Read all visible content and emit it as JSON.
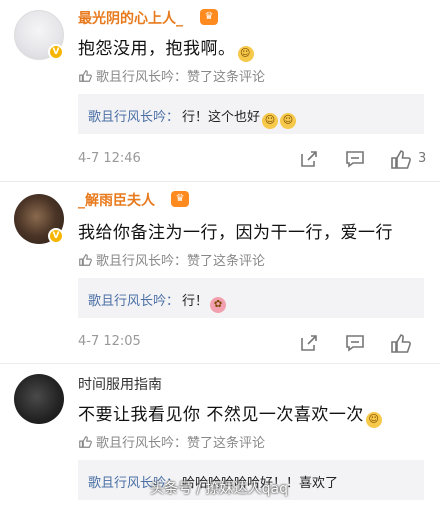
{
  "comments": [
    {
      "username": "最光阴的心上人_",
      "text": "抱怨没用，抱我啊。",
      "liked_by": "歌且行风长吟：赞了这条评论",
      "reply": {
        "name": "歌且行风长吟：",
        "text": "行！这个也好"
      },
      "timestamp": "4-7 12:46",
      "like_count": "3"
    },
    {
      "username": "_解雨臣夫人",
      "text": "我给你备注为一行，因为干一行，爱一行",
      "liked_by": "歌且行风长吟：赞了这条评论",
      "reply": {
        "name": "歌且行风长吟：",
        "text": "行！"
      },
      "timestamp": "4-7 12:05",
      "like_count": ""
    },
    {
      "username": "时间服用指南",
      "text": "不要让我看见你 不然见一次喜欢一次",
      "liked_by": "歌且行风长吟：赞了这条评论",
      "reply": {
        "name": "歌且行风长吟：",
        "text": "哈哈哈哈哈哈好！！喜欢了"
      }
    }
  ],
  "watermark": "头条号 / 撩妹达人qaq",
  "icons": {
    "verified": "verified-badge-icon",
    "medal": "medal-icon",
    "thumb": "thumbs-up-icon",
    "share": "share-icon",
    "comment": "comment-icon"
  },
  "colors": {
    "username": "#e87a1e",
    "reply_name": "#4a6fa5",
    "reply_bg": "#f3f3f5",
    "verified": "#f7b500"
  }
}
